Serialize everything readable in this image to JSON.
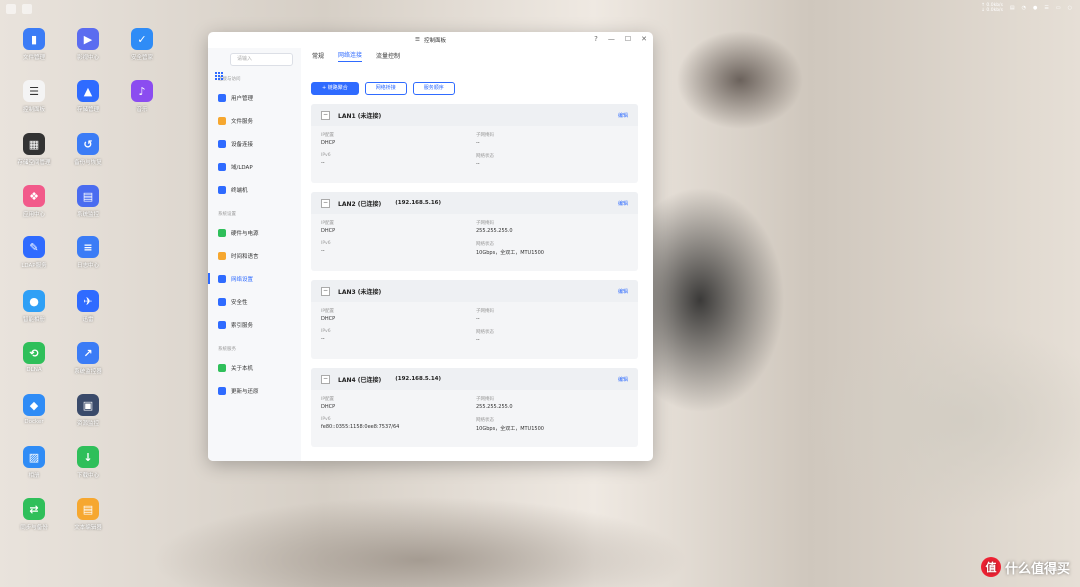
{
  "desktop_icons": [
    {
      "label": "文件管理",
      "color": "#3b7cf6",
      "glyph": "▮"
    },
    {
      "label": "影视中心",
      "color": "#5b6cf0",
      "glyph": "▶"
    },
    {
      "label": "安全管家",
      "color": "#2f8cf6",
      "glyph": "✓"
    },
    {
      "label": "控制面板",
      "color": "#f4f4f4",
      "glyph": "☰"
    },
    {
      "label": "存储管理",
      "color": "#2f6bff",
      "glyph": "▲"
    },
    {
      "label": "音乐",
      "color": "#8b4cf0",
      "glyph": "♪"
    },
    {
      "label": "存储空间管理",
      "color": "#333333",
      "glyph": "▦"
    },
    {
      "label": "备份与恢复",
      "color": "#3b7cf6",
      "glyph": "↺"
    },
    {
      "label": "应用中心",
      "color": "#f25a8a",
      "glyph": "❖"
    },
    {
      "label": "系统监控",
      "color": "#4a6cf0",
      "glyph": "▤"
    },
    {
      "label": "LDAP服务",
      "color": "#2f6bff",
      "glyph": "✎"
    },
    {
      "label": "日志中心",
      "color": "#3b7cf6",
      "glyph": "≡"
    },
    {
      "label": "智能相册",
      "color": "#2fa0f6",
      "glyph": "●"
    },
    {
      "label": "迅雷",
      "color": "#2f6bff",
      "glyph": "✈"
    },
    {
      "label": "DLNA",
      "color": "#2fbf5a",
      "glyph": "⟲"
    },
    {
      "label": "系统监控器",
      "color": "#3b7cf6",
      "glyph": "↗"
    },
    {
      "label": "Docker",
      "color": "#2f8cf6",
      "glyph": "◆"
    },
    {
      "label": "资源监控",
      "color": "#3a4a6a",
      "glyph": "▣"
    },
    {
      "label": "相册",
      "color": "#2f8cf6",
      "glyph": "▨"
    },
    {
      "label": "下载中心",
      "color": "#2fbf5a",
      "glyph": "↓"
    },
    {
      "label": "同步与备份",
      "color": "#2fbf5a",
      "glyph": "⇄"
    },
    {
      "label": "文本编辑器",
      "color": "#f6a72f",
      "glyph": "▤"
    }
  ],
  "tray": {
    "speed_up": "↑ 0.0kb/s",
    "speed_down": "↓ 0.0kb/s"
  },
  "window": {
    "title": "控制面板",
    "controls": {
      "help": "?",
      "min": "—",
      "max": "☐",
      "close": "✕"
    },
    "search_placeholder": "请输入",
    "sidebar": {
      "sections": [
        {
          "title": "连接与访问",
          "items": [
            {
              "label": "用户管理",
              "color": "#2f6bff"
            },
            {
              "label": "文件服务",
              "color": "#f6a72f"
            },
            {
              "label": "设备连接",
              "color": "#2f6bff"
            },
            {
              "label": "域/LDAP",
              "color": "#2f6bff"
            },
            {
              "label": "终端机",
              "color": "#2f6bff"
            }
          ]
        },
        {
          "title": "系统设置",
          "items": [
            {
              "label": "硬件与电源",
              "color": "#2fbf5a"
            },
            {
              "label": "时间和语言",
              "color": "#f6a72f"
            },
            {
              "label": "网络设置",
              "color": "#2f6bff"
            },
            {
              "label": "安全性",
              "color": "#2f6bff"
            },
            {
              "label": "索引服务",
              "color": "#2f6bff"
            }
          ]
        },
        {
          "title": "系统服务",
          "items": [
            {
              "label": "关于本机",
              "color": "#2fbf5a"
            },
            {
              "label": "更新与还原",
              "color": "#2f6bff"
            }
          ]
        }
      ],
      "active": "网络设置"
    },
    "tabs": [
      {
        "label": "常规",
        "active": false
      },
      {
        "label": "网络连接",
        "active": true
      },
      {
        "label": "流量控制",
        "active": false
      }
    ],
    "buttons": {
      "bond": "+ 链路聚合",
      "bridge": "网络桥接",
      "order": "服务顺序"
    },
    "edit_label": "编辑",
    "labels": {
      "ipv4": "IP配置",
      "mask": "子网掩码",
      "ipv6": "IPv6",
      "status": "网络状态"
    },
    "lans": [
      {
        "name": "LAN1 (未连接)",
        "ip": "",
        "ipv4": "DHCP",
        "mask": "--",
        "ipv6": "--",
        "status": "--"
      },
      {
        "name": "LAN2 (已连接)",
        "ip": "(192.168.5.16)",
        "ipv4": "DHCP",
        "mask": "255.255.255.0",
        "ipv6": "--",
        "status": "10Gbps，全双工，MTU1500"
      },
      {
        "name": "LAN3 (未连接)",
        "ip": "",
        "ipv4": "DHCP",
        "mask": "--",
        "ipv6": "--",
        "status": "--"
      },
      {
        "name": "LAN4 (已连接)",
        "ip": "(192.168.5.14)",
        "ipv4": "DHCP",
        "mask": "255.255.255.0",
        "ipv6": "fe80::0355:1158:0ee8:7537/64",
        "status": "10Gbps，全双工，MTU1500"
      }
    ]
  },
  "watermark": {
    "logo": "值",
    "text": "什么值得买"
  }
}
